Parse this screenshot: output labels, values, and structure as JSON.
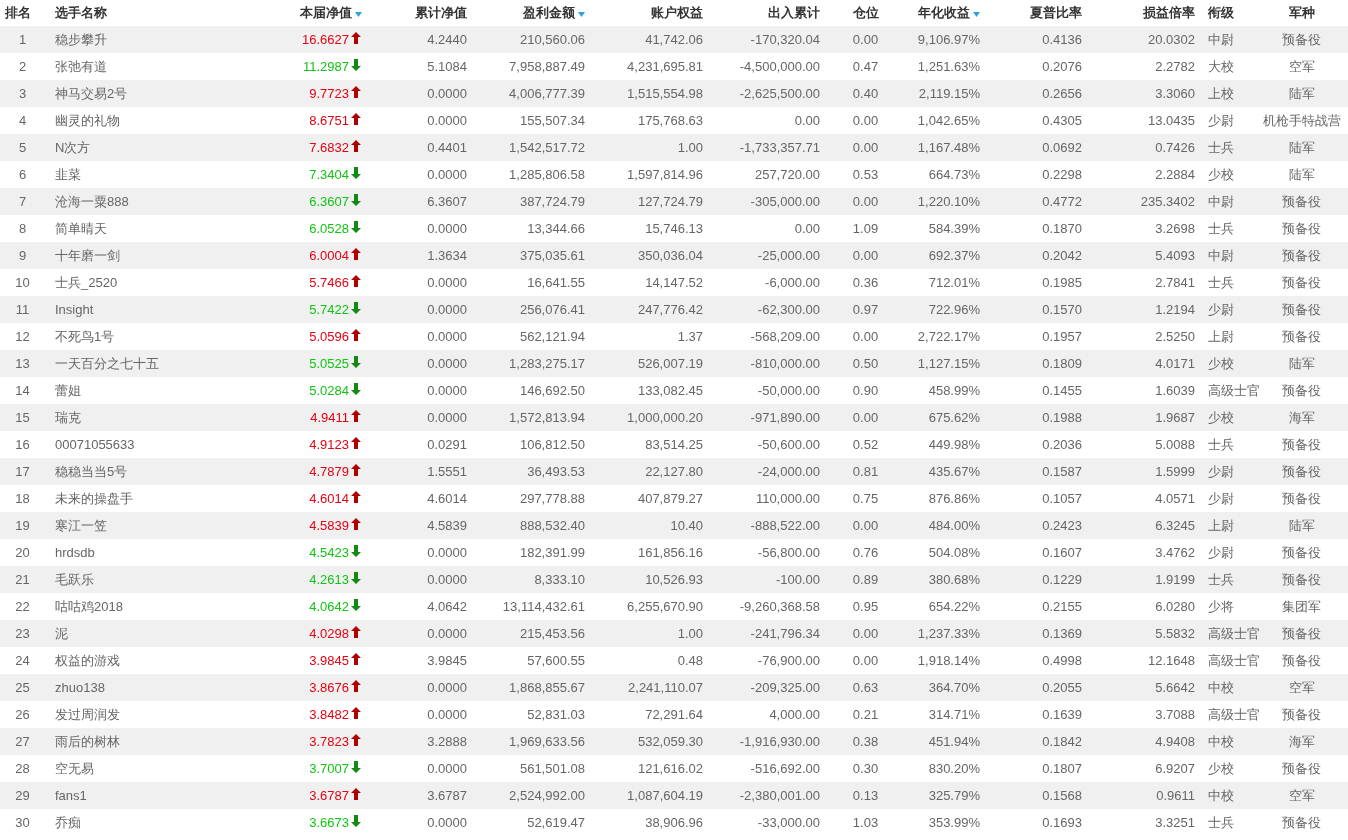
{
  "table": {
    "columns": [
      {
        "label": "排名",
        "sortable": false
      },
      {
        "label": "选手名称",
        "sortable": false
      },
      {
        "label": "本届净值",
        "sortable": true
      },
      {
        "label": "累计净值",
        "sortable": false
      },
      {
        "label": "盈利金额",
        "sortable": true
      },
      {
        "label": "账户权益",
        "sortable": false
      },
      {
        "label": "出入累计",
        "sortable": false
      },
      {
        "label": "仓位",
        "sortable": false
      },
      {
        "label": "年化收益",
        "sortable": true
      },
      {
        "label": "夏普比率",
        "sortable": false
      },
      {
        "label": "损益倍率",
        "sortable": false
      },
      {
        "label": "衔级",
        "sortable": false
      },
      {
        "label": "军种",
        "sortable": false
      }
    ],
    "rows": [
      {
        "rising": true,
        "cells": [
          "1",
          "稳步攀升",
          "16.6627",
          "4.2440",
          "210,560.06",
          "41,742.06",
          "-170,320.04",
          "0.00",
          "9,106.97%",
          "0.4136",
          "20.0302",
          "中尉",
          "预备役"
        ]
      },
      {
        "rising": false,
        "cells": [
          "2",
          "张弛有道",
          "11.2987",
          "5.1084",
          "7,958,887.49",
          "4,231,695.81",
          "-4,500,000.00",
          "0.47",
          "1,251.63%",
          "0.2076",
          "2.2782",
          "大校",
          "空军"
        ]
      },
      {
        "rising": true,
        "cells": [
          "3",
          "神马交易2号",
          "9.7723",
          "0.0000",
          "4,006,777.39",
          "1,515,554.98",
          "-2,625,500.00",
          "0.40",
          "2,119.15%",
          "0.2656",
          "3.3060",
          "上校",
          "陆军"
        ]
      },
      {
        "rising": true,
        "cells": [
          "4",
          "幽灵的礼物",
          "8.6751",
          "0.0000",
          "155,507.34",
          "175,768.63",
          "0.00",
          "0.00",
          "1,042.65%",
          "0.4305",
          "13.0435",
          "少尉",
          "机枪手特战营"
        ]
      },
      {
        "rising": true,
        "cells": [
          "5",
          "N次方",
          "7.6832",
          "0.4401",
          "1,542,517.72",
          "1.00",
          "-1,733,357.71",
          "0.00",
          "1,167.48%",
          "0.0692",
          "0.7426",
          "士兵",
          "陆军"
        ]
      },
      {
        "rising": false,
        "cells": [
          "6",
          "韭菜",
          "7.3404",
          "0.0000",
          "1,285,806.58",
          "1,597,814.96",
          "257,720.00",
          "0.53",
          "664.73%",
          "0.2298",
          "2.2884",
          "少校",
          "陆军"
        ]
      },
      {
        "rising": false,
        "cells": [
          "7",
          "沧海一粟888",
          "6.3607",
          "6.3607",
          "387,724.79",
          "127,724.79",
          "-305,000.00",
          "0.00",
          "1,220.10%",
          "0.4772",
          "235.3402",
          "中尉",
          "预备役"
        ]
      },
      {
        "rising": false,
        "cells": [
          "8",
          "简单晴天",
          "6.0528",
          "0.0000",
          "13,344.66",
          "15,746.13",
          "0.00",
          "1.09",
          "584.39%",
          "0.1870",
          "3.2698",
          "士兵",
          "预备役"
        ]
      },
      {
        "rising": true,
        "cells": [
          "9",
          "十年磨一剑",
          "6.0004",
          "1.3634",
          "375,035.61",
          "350,036.04",
          "-25,000.00",
          "0.00",
          "692.37%",
          "0.2042",
          "5.4093",
          "中尉",
          "预备役"
        ]
      },
      {
        "rising": true,
        "cells": [
          "10",
          "士兵_2520",
          "5.7466",
          "0.0000",
          "16,641.55",
          "14,147.52",
          "-6,000.00",
          "0.36",
          "712.01%",
          "0.1985",
          "2.7841",
          "士兵",
          "预备役"
        ]
      },
      {
        "rising": false,
        "cells": [
          "11",
          "Insight",
          "5.7422",
          "0.0000",
          "256,076.41",
          "247,776.42",
          "-62,300.00",
          "0.97",
          "722.96%",
          "0.1570",
          "1.2194",
          "少尉",
          "预备役"
        ]
      },
      {
        "rising": true,
        "cells": [
          "12",
          "不死鸟1号",
          "5.0596",
          "0.0000",
          "562,121.94",
          "1.37",
          "-568,209.00",
          "0.00",
          "2,722.17%",
          "0.1957",
          "2.5250",
          "上尉",
          "预备役"
        ]
      },
      {
        "rising": false,
        "cells": [
          "13",
          "一天百分之七十五",
          "5.0525",
          "0.0000",
          "1,283,275.17",
          "526,007.19",
          "-810,000.00",
          "0.50",
          "1,127.15%",
          "0.1809",
          "4.0171",
          "少校",
          "陆军"
        ]
      },
      {
        "rising": false,
        "cells": [
          "14",
          "蕾姐",
          "5.0284",
          "0.0000",
          "146,692.50",
          "133,082.45",
          "-50,000.00",
          "0.90",
          "458.99%",
          "0.1455",
          "1.6039",
          "高级士官",
          "预备役"
        ]
      },
      {
        "rising": true,
        "cells": [
          "15",
          "瑞克",
          "4.9411",
          "0.0000",
          "1,572,813.94",
          "1,000,000.20",
          "-971,890.00",
          "0.00",
          "675.62%",
          "0.1988",
          "1.9687",
          "少校",
          "海军"
        ]
      },
      {
        "rising": true,
        "cells": [
          "16",
          "00071055633",
          "4.9123",
          "0.0291",
          "106,812.50",
          "83,514.25",
          "-50,600.00",
          "0.52",
          "449.98%",
          "0.2036",
          "5.0088",
          "士兵",
          "预备役"
        ]
      },
      {
        "rising": true,
        "cells": [
          "17",
          "稳稳当当5号",
          "4.7879",
          "1.5551",
          "36,493.53",
          "22,127.80",
          "-24,000.00",
          "0.81",
          "435.67%",
          "0.1587",
          "1.5999",
          "少尉",
          "预备役"
        ]
      },
      {
        "rising": true,
        "cells": [
          "18",
          "未来的操盘手",
          "4.6014",
          "4.6014",
          "297,778.88",
          "407,879.27",
          "110,000.00",
          "0.75",
          "876.86%",
          "0.1057",
          "4.0571",
          "少尉",
          "预备役"
        ]
      },
      {
        "rising": true,
        "cells": [
          "19",
          "寒江一笠",
          "4.5839",
          "4.5839",
          "888,532.40",
          "10.40",
          "-888,522.00",
          "0.00",
          "484.00%",
          "0.2423",
          "6.3245",
          "上尉",
          "陆军"
        ]
      },
      {
        "rising": false,
        "cells": [
          "20",
          "hrdsdb",
          "4.5423",
          "0.0000",
          "182,391.99",
          "161,856.16",
          "-56,800.00",
          "0.76",
          "504.08%",
          "0.1607",
          "3.4762",
          "少尉",
          "预备役"
        ]
      },
      {
        "rising": false,
        "cells": [
          "21",
          "毛跃乐",
          "4.2613",
          "0.0000",
          "8,333.10",
          "10,526.93",
          "-100.00",
          "0.89",
          "380.68%",
          "0.1229",
          "1.9199",
          "士兵",
          "预备役"
        ]
      },
      {
        "rising": false,
        "cells": [
          "22",
          "咕咕鸡2018",
          "4.0642",
          "4.0642",
          "13,114,432.61",
          "6,255,670.90",
          "-9,260,368.58",
          "0.95",
          "654.22%",
          "0.2155",
          "6.0280",
          "少将",
          "集团军"
        ]
      },
      {
        "rising": true,
        "cells": [
          "23",
          "泥",
          "4.0298",
          "0.0000",
          "215,453.56",
          "1.00",
          "-241,796.34",
          "0.00",
          "1,237.33%",
          "0.1369",
          "5.5832",
          "高级士官",
          "预备役"
        ]
      },
      {
        "rising": true,
        "cells": [
          "24",
          "权益的游戏",
          "3.9845",
          "3.9845",
          "57,600.55",
          "0.48",
          "-76,900.00",
          "0.00",
          "1,918.14%",
          "0.4998",
          "12.1648",
          "高级士官",
          "预备役"
        ]
      },
      {
        "rising": true,
        "cells": [
          "25",
          "zhuo138",
          "3.8676",
          "0.0000",
          "1,868,855.67",
          "2,241,110.07",
          "-209,325.00",
          "0.63",
          "364.70%",
          "0.2055",
          "5.6642",
          "中校",
          "空军"
        ]
      },
      {
        "rising": true,
        "cells": [
          "26",
          "发过周润发",
          "3.8482",
          "0.0000",
          "52,831.03",
          "72,291.64",
          "4,000.00",
          "0.21",
          "314.71%",
          "0.1639",
          "3.7088",
          "高级士官",
          "预备役"
        ]
      },
      {
        "rising": true,
        "cells": [
          "27",
          "雨后的树林",
          "3.7823",
          "3.2888",
          "1,969,633.56",
          "532,059.30",
          "-1,916,930.00",
          "0.38",
          "451.94%",
          "0.1842",
          "4.9408",
          "中校",
          "海军"
        ]
      },
      {
        "rising": false,
        "cells": [
          "28",
          "空无易",
          "3.7007",
          "0.0000",
          "561,501.08",
          "121,616.02",
          "-516,692.00",
          "0.30",
          "830.20%",
          "0.1807",
          "6.9207",
          "少校",
          "预备役"
        ]
      },
      {
        "rising": true,
        "cells": [
          "29",
          "fans1",
          "3.6787",
          "3.6787",
          "2,524,992.00",
          "1,087,604.19",
          "-2,380,001.00",
          "0.13",
          "325.79%",
          "0.1568",
          "0.9611",
          "中校",
          "空军"
        ]
      },
      {
        "rising": false,
        "cells": [
          "30",
          "乔痴",
          "3.6673",
          "0.0000",
          "52,619.47",
          "38,906.96",
          "-33,000.00",
          "1.03",
          "353.99%",
          "0.1693",
          "3.3251",
          "士兵",
          "预备役"
        ]
      }
    ]
  }
}
